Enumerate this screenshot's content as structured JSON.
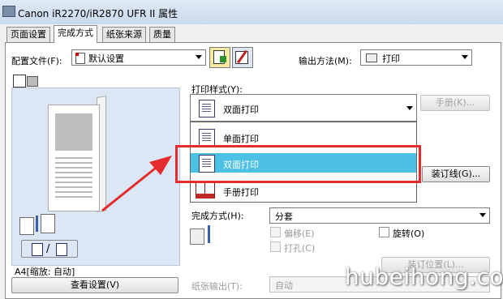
{
  "window": {
    "title": "Canon iR2270/iR2870 UFR II 属性"
  },
  "tabs": [
    {
      "label": "页面设置",
      "active": false
    },
    {
      "label": "完成方式",
      "active": true
    },
    {
      "label": "纸张来源",
      "active": false
    },
    {
      "label": "质量",
      "active": false
    }
  ],
  "profile": {
    "label": "配置文件(F):",
    "value": "默认设置"
  },
  "output_method": {
    "label": "输出方法(M):",
    "value": "打印"
  },
  "print_style": {
    "label": "打印样式(Y):",
    "value": "双面打印",
    "booklet_button": "手册(K)...",
    "options": [
      {
        "label": "单面打印",
        "selected": false
      },
      {
        "label": "双面打印",
        "selected": true
      },
      {
        "label": "手册打印",
        "selected": false
      }
    ]
  },
  "binding_button": "装订线(G)...",
  "paper_info": "A4[缩放: 自动]",
  "view_settings_button": "查看设置(V)",
  "finishing": {
    "label": "完成方式(H):",
    "value": "分套",
    "offset": "偏移(E)",
    "rotate": "旋转(O)",
    "punch": "打孔(C)",
    "staple_position_button": "装订位置(L)..."
  },
  "paper_output": {
    "label": "纸张输出(T):",
    "value": "自动"
  },
  "watermark": "hubeihong.com",
  "colors": {
    "selection": "#4dc1e4",
    "highlight_box": "#e52b2b",
    "arrow": "#e52b2b"
  }
}
